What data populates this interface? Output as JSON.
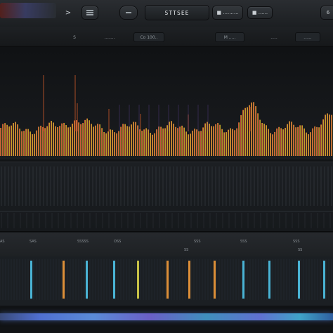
{
  "toolbar": {
    "play_glyph": ">",
    "meter_label": "",
    "loop_label": "",
    "display_text": "STTSEE",
    "mode_label": "■ ..........",
    "options_label": "■ ......",
    "corner_label": "6"
  },
  "control_row": {
    "items": [
      "S",
      "........",
      "Co 100..",
      "M  .....",
      "..... ",
      "......"
    ]
  },
  "ruler": {
    "labels": [
      "AS",
      "SAS",
      "SSSSS",
      "OSS",
      "SSS",
      "SSS",
      "SSS",
      "SS",
      "SS"
    ]
  },
  "colors": {
    "spectrum_low": "#c0281a",
    "spectrum_mid": "#f08a1e",
    "spectrum_high": "#e8c22a",
    "spectrum_green": "#7fd23a",
    "marker_cyan": "#4fc3e8",
    "marker_orange": "#f29a3a",
    "marker_yellow": "#d9d24a",
    "bottom_stripe": "#5a8bd8"
  },
  "markers": [
    {
      "color": "cyan"
    },
    {
      "color": "orange"
    },
    {
      "color": "cyan"
    },
    {
      "color": "cyan"
    },
    {
      "color": "yellow"
    },
    {
      "color": "orange"
    },
    {
      "color": "orange"
    },
    {
      "color": "orange"
    },
    {
      "color": "cyan"
    },
    {
      "color": "cyan"
    },
    {
      "color": "cyan"
    },
    {
      "color": "cyan"
    }
  ]
}
